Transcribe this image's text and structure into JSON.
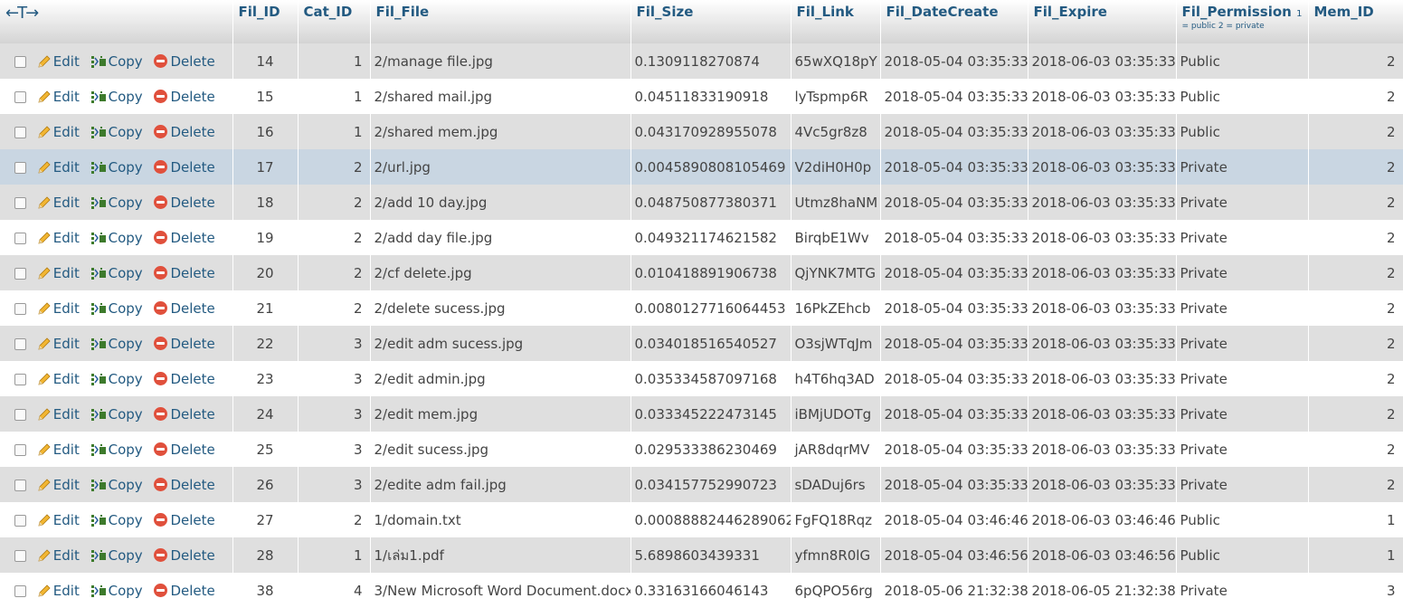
{
  "header": {
    "nav_arrows": "←T→",
    "columns": [
      "Fil_ID",
      "Cat_ID",
      "Fil_File",
      "Fil_Size",
      "Fil_Link",
      "Fil_DateCreate",
      "Fil_Expire",
      "Fil_Permission",
      "Mem_ID"
    ],
    "permission_sort": "1",
    "permission_note": "= public 2 = private"
  },
  "actions": {
    "edit": "Edit",
    "copy": "Copy",
    "delete": "Delete"
  },
  "rows": [
    {
      "id": "14",
      "cat": "1",
      "file": "2/manage file.jpg",
      "size": "0.1309118270874",
      "link": "65wXQ18pY",
      "created": "2018-05-04 03:35:33",
      "expire": "2018-06-03 03:35:33",
      "perm": "Public",
      "mem": "2"
    },
    {
      "id": "15",
      "cat": "1",
      "file": "2/shared mail.jpg",
      "size": "0.04511833190918",
      "link": "lyTspmp6R",
      "created": "2018-05-04 03:35:33",
      "expire": "2018-06-03 03:35:33",
      "perm": "Public",
      "mem": "2"
    },
    {
      "id": "16",
      "cat": "1",
      "file": "2/shared mem.jpg",
      "size": "0.043170928955078",
      "link": "4Vc5gr8z8",
      "created": "2018-05-04 03:35:33",
      "expire": "2018-06-03 03:35:33",
      "perm": "Public",
      "mem": "2"
    },
    {
      "id": "17",
      "cat": "2",
      "file": "2/url.jpg",
      "size": "0.0045890808105469",
      "link": "V2diH0H0p",
      "created": "2018-05-04 03:35:33",
      "expire": "2018-06-03 03:35:33",
      "perm": "Private",
      "mem": "2"
    },
    {
      "id": "18",
      "cat": "2",
      "file": "2/add 10 day.jpg",
      "size": "0.048750877380371",
      "link": "Utmz8haNM",
      "created": "2018-05-04 03:35:33",
      "expire": "2018-06-03 03:35:33",
      "perm": "Private",
      "mem": "2"
    },
    {
      "id": "19",
      "cat": "2",
      "file": "2/add day file.jpg",
      "size": "0.049321174621582",
      "link": "BirqbE1Wv",
      "created": "2018-05-04 03:35:33",
      "expire": "2018-06-03 03:35:33",
      "perm": "Private",
      "mem": "2"
    },
    {
      "id": "20",
      "cat": "2",
      "file": "2/cf delete.jpg",
      "size": "0.010418891906738",
      "link": "QjYNK7MTG",
      "created": "2018-05-04 03:35:33",
      "expire": "2018-06-03 03:35:33",
      "perm": "Private",
      "mem": "2"
    },
    {
      "id": "21",
      "cat": "2",
      "file": "2/delete sucess.jpg",
      "size": "0.0080127716064453",
      "link": "16PkZEhcb",
      "created": "2018-05-04 03:35:33",
      "expire": "2018-06-03 03:35:33",
      "perm": "Private",
      "mem": "2"
    },
    {
      "id": "22",
      "cat": "3",
      "file": "2/edit adm sucess.jpg",
      "size": "0.034018516540527",
      "link": "O3sjWTqJm",
      "created": "2018-05-04 03:35:33",
      "expire": "2018-06-03 03:35:33",
      "perm": "Private",
      "mem": "2"
    },
    {
      "id": "23",
      "cat": "3",
      "file": "2/edit admin.jpg",
      "size": "0.035334587097168",
      "link": "h4T6hq3AD",
      "created": "2018-05-04 03:35:33",
      "expire": "2018-06-03 03:35:33",
      "perm": "Private",
      "mem": "2"
    },
    {
      "id": "24",
      "cat": "3",
      "file": "2/edit mem.jpg",
      "size": "0.033345222473145",
      "link": "iBMjUDOTg",
      "created": "2018-05-04 03:35:33",
      "expire": "2018-06-03 03:35:33",
      "perm": "Private",
      "mem": "2"
    },
    {
      "id": "25",
      "cat": "3",
      "file": "2/edit sucess.jpg",
      "size": "0.029533386230469",
      "link": "jAR8dqrMV",
      "created": "2018-05-04 03:35:33",
      "expire": "2018-06-03 03:35:33",
      "perm": "Private",
      "mem": "2"
    },
    {
      "id": "26",
      "cat": "3",
      "file": "2/edite adm fail.jpg",
      "size": "0.034157752990723",
      "link": "sDADuj6rs",
      "created": "2018-05-04 03:35:33",
      "expire": "2018-06-03 03:35:33",
      "perm": "Private",
      "mem": "2"
    },
    {
      "id": "27",
      "cat": "2",
      "file": "1/domain.txt",
      "size": "0.00088882446289062",
      "link": "FgFQ18Rqz",
      "created": "2018-05-04 03:46:46",
      "expire": "2018-06-03 03:46:46",
      "perm": "Public",
      "mem": "1"
    },
    {
      "id": "28",
      "cat": "1",
      "file": "1/เล่ม1.pdf",
      "size": "5.6898603439331",
      "link": "yfmn8R0lG",
      "created": "2018-05-04 03:46:56",
      "expire": "2018-06-03 03:46:56",
      "perm": "Public",
      "mem": "1"
    },
    {
      "id": "38",
      "cat": "4",
      "file": "3/New Microsoft Word Document.docx",
      "size": "0.33163166046143",
      "link": "6pQPO56rg",
      "created": "2018-05-06 21:32:38",
      "expire": "2018-06-05 21:32:38",
      "perm": "Private",
      "mem": "3"
    }
  ]
}
